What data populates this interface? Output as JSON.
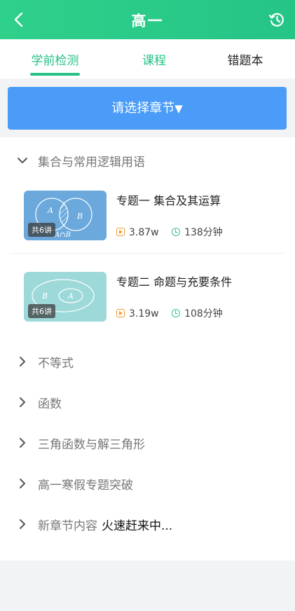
{
  "header": {
    "title": "高一",
    "back_icon": "back-chevron-icon",
    "history_icon": "history-clock-icon",
    "bg_color": "#2ccd88"
  },
  "tabs": [
    {
      "label": "学前检测",
      "active": true
    },
    {
      "label": "课程",
      "active": false
    },
    {
      "label": "错题本",
      "active": false
    }
  ],
  "chapter_select": {
    "label": "请选择章节",
    "arrow": "▼",
    "color": "#4a9cf8"
  },
  "sections": [
    {
      "label": "集合与常用逻辑用语",
      "expanded": true,
      "courses": [
        {
          "title": "专题一 集合及其运算",
          "badge": "共6讲",
          "plays": "3.87w",
          "duration": "138分钟"
        },
        {
          "title": "专题二 命题与充要条件",
          "badge": "共6讲",
          "plays": "3.19w",
          "duration": "108分钟"
        }
      ]
    },
    {
      "label": "不等式",
      "expanded": false
    },
    {
      "label": "函数",
      "expanded": false
    },
    {
      "label": "三角函数与解三角形",
      "expanded": false
    },
    {
      "label": "高一寒假专题突破",
      "expanded": false
    },
    {
      "label": "新章节内容",
      "expanded": false,
      "extra": "火速赶来中..."
    }
  ]
}
